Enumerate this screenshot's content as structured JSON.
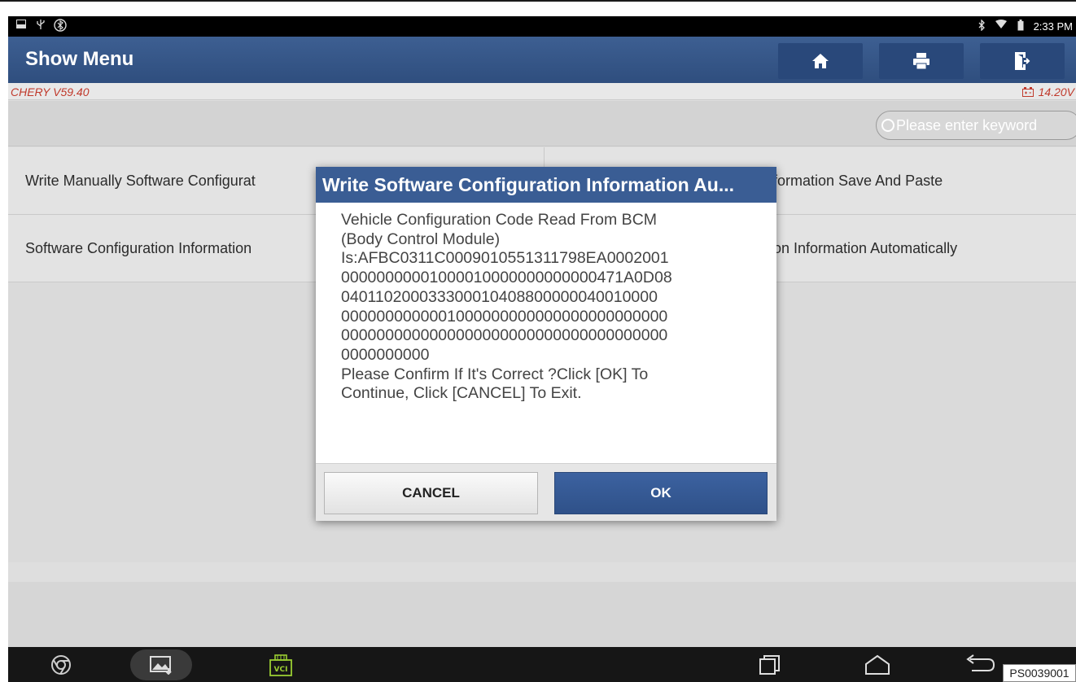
{
  "status_bar": {
    "time": "2:33 PM",
    "left_icons": [
      "window-icon",
      "usb-icon",
      "bluetooth-circle-icon"
    ],
    "right_icons": [
      "bluetooth-icon",
      "wifi-icon",
      "battery-icon"
    ]
  },
  "header": {
    "title": "Show Menu",
    "buttons": [
      "home-icon",
      "print-icon",
      "exit-icon"
    ]
  },
  "info_bar": {
    "brand": "CHERY V59.40",
    "voltage": "14.20V"
  },
  "search": {
    "placeholder": "Please enter keyword"
  },
  "menu": {
    "items": [
      "Write Manually Software Configurat",
      "formation Save And Paste",
      "Software Configuration Information",
      "on Information Automatically"
    ]
  },
  "dialog": {
    "title": "Write Software Configuration Information Au...",
    "lines": [
      "Vehicle Configuration Code Read From BCM",
      "(Body Control Module)",
      "Is:AFBC0311C0009010551311798EA0002001",
      "00000000001000010000000000000471A0D08",
      "04011020003330001040880000004001000​0",
      "0000000000001000000000000000000000000",
      "0000000000000000000000000000000000000",
      "0000000000",
      "Please Confirm If It's Correct ?Click [OK] To",
      "Continue, Click [CANCEL] To Exit."
    ],
    "cancel_label": "CANCEL",
    "ok_label": "OK"
  },
  "nav_bar": {
    "icons": [
      "chrome-icon",
      "gallery-icon",
      "vci-icon",
      "recent-apps-icon",
      "home-nav-icon",
      "back-icon"
    ],
    "vci_label": "VCI"
  },
  "ps_label": "PS0039001",
  "colors": {
    "header": "#3d5f92",
    "dialog_title": "#3a5d94",
    "ok_button": "#2f5189",
    "brand_text": "#c0392b"
  }
}
